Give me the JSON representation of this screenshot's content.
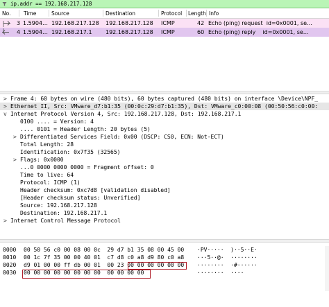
{
  "filter": {
    "text": "ip.addr == 192.168.217.128"
  },
  "columns": [
    "No.",
    "Time",
    "Source",
    "Destination",
    "Protocol",
    "Length",
    "Info"
  ],
  "packets": [
    {
      "no": "3",
      "time": "1.5904…",
      "source": "192.168.217.128",
      "destination": "192.168.217.128",
      "protocol": "ICMP",
      "length": "42",
      "info": "Echo (ping) request  id=0x0001, se…"
    },
    {
      "no": "4",
      "time": "1.5904…",
      "source": "192.168.217.1",
      "destination": "192.168.217.128",
      "protocol": "ICMP",
      "length": "60",
      "info": "Echo (ping) reply    id=0x0001, se…"
    }
  ],
  "details": [
    {
      "arrow": ">",
      "text": "Frame 4: 60 bytes on wire (480 bits), 60 bytes captured (480 bits) on interface \\Device\\NPF_",
      "indent": 0
    },
    {
      "arrow": ">",
      "text": "Ethernet II, Src: VMware_d7:b1:35 (00:0c:29:d7:b1:35), Dst: VMware_c0:00:08 (00:50:56:c0:00:",
      "indent": 0
    },
    {
      "arrow": "v",
      "text": "Internet Protocol Version 4, Src: 192.168.217.128, Dst: 192.168.217.1",
      "indent": 0
    },
    {
      "arrow": "",
      "text": "0100 .... = Version: 4",
      "indent": 1
    },
    {
      "arrow": "",
      "text": ".... 0101 = Header Length: 20 bytes (5)",
      "indent": 1
    },
    {
      "arrow": ">",
      "text": "Differentiated Services Field: 0x00 (DSCP: CS0, ECN: Not-ECT)",
      "indent": 1
    },
    {
      "arrow": "",
      "text": "Total Length: 28",
      "indent": 1
    },
    {
      "arrow": "",
      "text": "Identification: 0x7f35 (32565)",
      "indent": 1
    },
    {
      "arrow": ">",
      "text": "Flags: 0x0000",
      "indent": 1
    },
    {
      "arrow": "",
      "text": "...0 0000 0000 0000 = Fragment offset: 0",
      "indent": 1
    },
    {
      "arrow": "",
      "text": "Time to live: 64",
      "indent": 1
    },
    {
      "arrow": "",
      "text": "Protocol: ICMP (1)",
      "indent": 1
    },
    {
      "arrow": "",
      "text": "Header checksum: 0xc7d8 [validation disabled]",
      "indent": 1
    },
    {
      "arrow": "",
      "text": "[Header checksum status: Unverified]",
      "indent": 1
    },
    {
      "arrow": "",
      "text": "Source: 192.168.217.128",
      "indent": 1
    },
    {
      "arrow": "",
      "text": "Destination: 192.168.217.1",
      "indent": 1
    },
    {
      "arrow": ">",
      "text": "Internet Control Message Protocol",
      "indent": 0
    }
  ],
  "bytes": [
    {
      "offset": "0000",
      "hex": "00 50 56 c0 00 08 00 0c  29 d7 b1 35 08 00 45 00",
      "ascii": "·PV·····  )··5··E·"
    },
    {
      "offset": "0010",
      "hex": "00 1c 7f 35 00 00 40 01  c7 d8 c0 a8 d9 80 c0 a8",
      "ascii": "···5··@·  ········"
    },
    {
      "offset": "0020",
      "hex": "d9 01 00 00 ff db 00 01  00 23 00 00 00 00 00 00",
      "ascii": "········  ·#······"
    },
    {
      "offset": "0030",
      "hex": "00 00 00 00 00 00 00 00  00 00 00 00",
      "ascii": "········  ····"
    }
  ]
}
